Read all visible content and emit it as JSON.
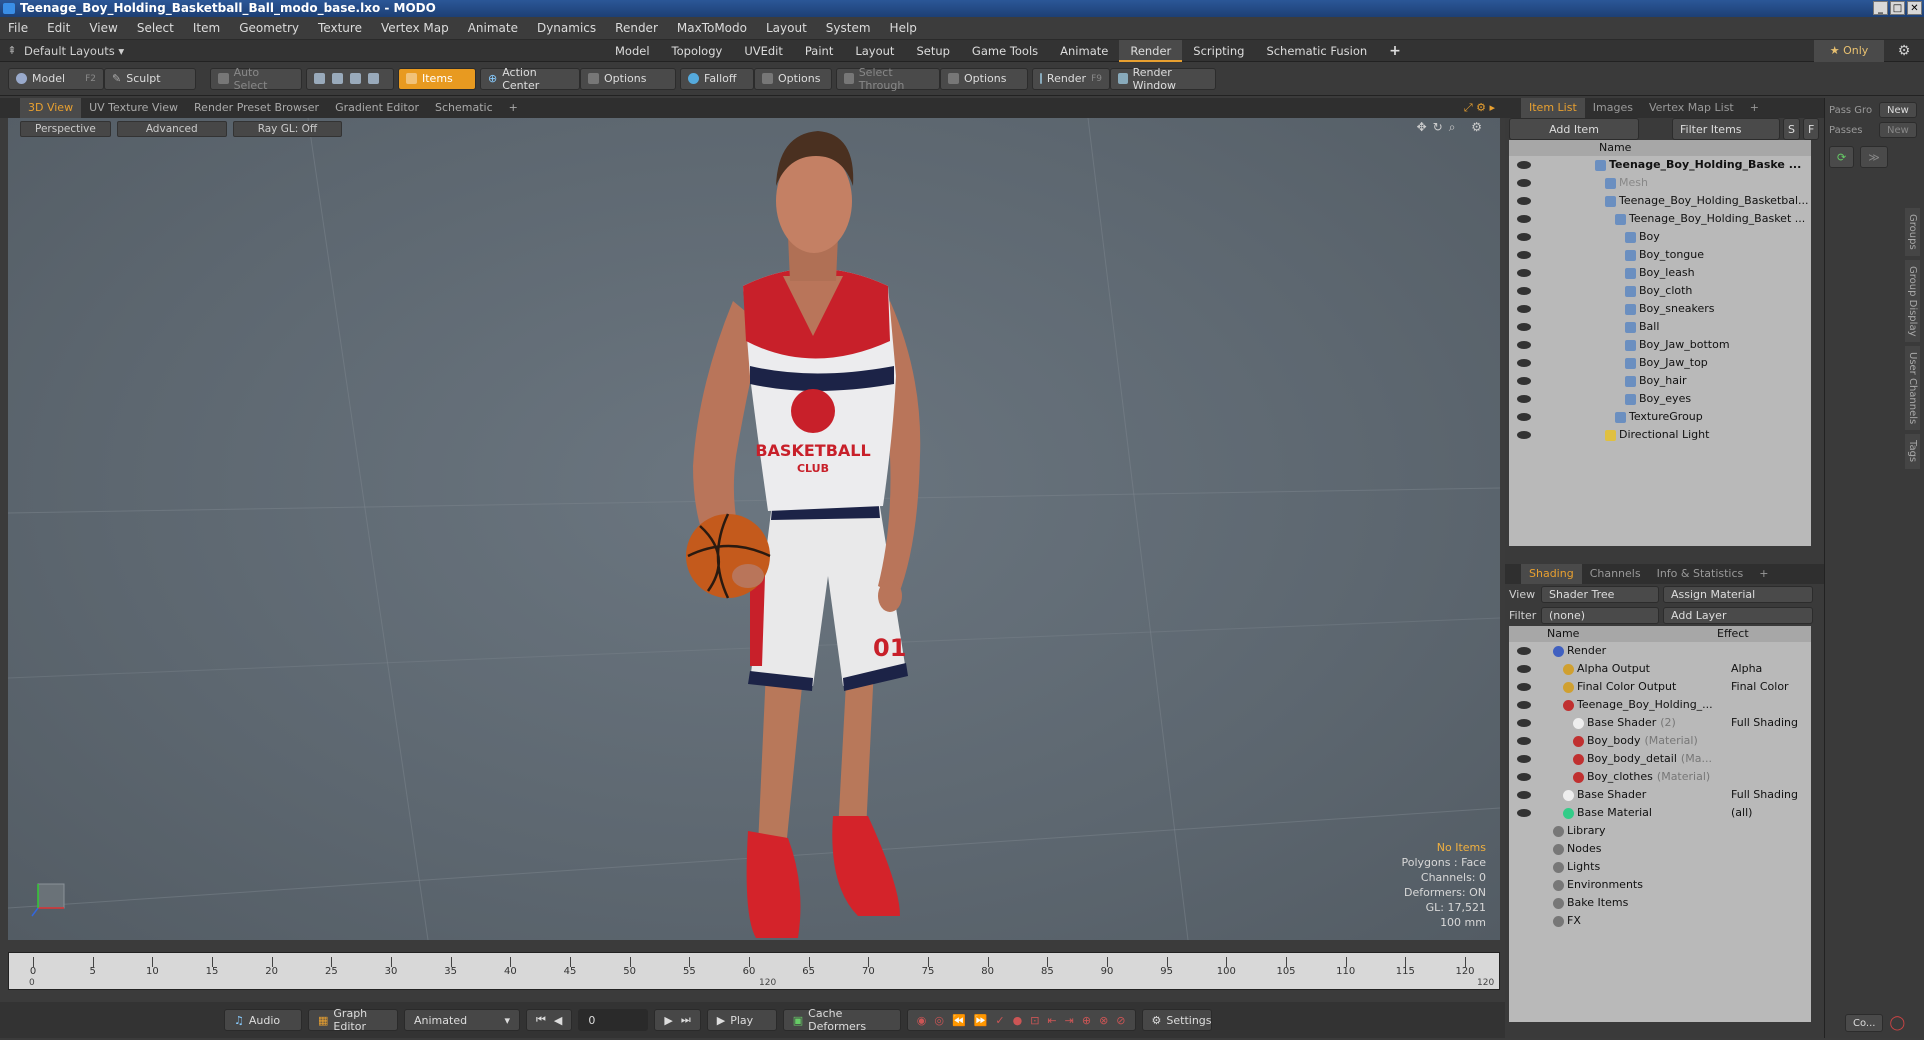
{
  "window": {
    "title": "Teenage_Boy_Holding_Basketball_Ball_modo_base.lxo - MODO"
  },
  "menu": [
    "File",
    "Edit",
    "View",
    "Select",
    "Item",
    "Geometry",
    "Texture",
    "Vertex Map",
    "Animate",
    "Dynamics",
    "Render",
    "MaxToModo",
    "Layout",
    "System",
    "Help"
  ],
  "layouts": {
    "default": "Default Layouts ▾",
    "tabs": [
      "Model",
      "Topology",
      "UVEdit",
      "Paint",
      "Layout",
      "Setup",
      "Game Tools",
      "Animate",
      "Render",
      "Scripting",
      "Schematic Fusion",
      "+"
    ],
    "only": "★ Only"
  },
  "toolbar": {
    "model": "Model",
    "model_key": "F2",
    "sculpt": "Sculpt",
    "auto_select": "Auto Select",
    "items": "Items",
    "action_center": "Action Center",
    "options1": "Options",
    "falloff": "Falloff",
    "options2": "Options",
    "select_through": "Select Through",
    "options3": "Options",
    "render": "Render",
    "render_key": "F9",
    "render_window": "Render Window"
  },
  "viewport": {
    "tabs": [
      "3D View",
      "UV Texture View",
      "Render Preset Browser",
      "Gradient Editor",
      "Schematic",
      "+"
    ],
    "perspective": "Perspective",
    "advanced": "Advanced",
    "raygl": "Ray GL: Off",
    "stats": {
      "no_items": "No Items",
      "polygons": "Polygons : Face",
      "channels": "Channels: 0",
      "deformers": "Deformers: ON",
      "gl": "GL: 17,521",
      "size": "100 mm"
    },
    "jersey_text": "BASKETBALL",
    "jersey_sub": "CLUB",
    "shorts_number": "01"
  },
  "timeline": {
    "ticks": [
      "0",
      "5",
      "10",
      "15",
      "20",
      "25",
      "30",
      "35",
      "40",
      "45",
      "50",
      "55",
      "60",
      "65",
      "70",
      "75",
      "80",
      "85",
      "90",
      "95",
      "100",
      "105",
      "110",
      "115",
      "120"
    ],
    "start": "0",
    "mid": "120",
    "end": "120"
  },
  "bottom": {
    "audio": "Audio",
    "graph_editor": "Graph Editor",
    "animated": "Animated",
    "frame": "0",
    "play": "Play",
    "cache": "Cache Deformers",
    "settings": "Settings"
  },
  "itemlist": {
    "tabs": [
      "Item List",
      "Images",
      "Vertex Map List",
      "+"
    ],
    "add_item": "Add Item",
    "filter": "Filter Items",
    "s": "S",
    "f": "F",
    "name_header": "Name",
    "items": [
      "Teenage_Boy_Holding_Baske ...",
      "Mesh",
      "Teenage_Boy_Holding_Basketbal...",
      "Teenage_Boy_Holding_Basket ...",
      "Boy",
      "Boy_tongue",
      "Boy_leash",
      "Boy_cloth",
      "Boy_sneakers",
      "Ball",
      "Boy_Jaw_bottom",
      "Boy_Jaw_top",
      "Boy_hair",
      "Boy_eyes",
      "TextureGroup",
      "Directional Light"
    ]
  },
  "shading": {
    "tabs": [
      "Shading",
      "Channels",
      "Info & Statistics",
      "+"
    ],
    "view_label": "View",
    "view_value": "Shader Tree",
    "assign": "Assign Material",
    "filter_label": "Filter",
    "filter_value": "(none)",
    "add_layer": "Add Layer",
    "name_header": "Name",
    "effect_header": "Effect",
    "rows": [
      {
        "name": "Render",
        "extra": "",
        "effect": ""
      },
      {
        "name": "Alpha Output",
        "extra": "",
        "effect": "Alpha"
      },
      {
        "name": "Final Color Output",
        "extra": "",
        "effect": "Final Color"
      },
      {
        "name": "Teenage_Boy_Holding_...",
        "extra": "",
        "effect": ""
      },
      {
        "name": "Base Shader",
        "extra": "(2)",
        "effect": "Full Shading"
      },
      {
        "name": "Boy_body",
        "extra": "(Material)",
        "effect": ""
      },
      {
        "name": "Boy_body_detail",
        "extra": "(Ma...",
        "effect": ""
      },
      {
        "name": "Boy_clothes",
        "extra": "(Material)",
        "effect": ""
      },
      {
        "name": "Base Shader",
        "extra": "",
        "effect": "Full Shading"
      },
      {
        "name": "Base Material",
        "extra": "",
        "effect": "(all)"
      },
      {
        "name": "Library",
        "extra": "",
        "effect": ""
      },
      {
        "name": "Nodes",
        "extra": "",
        "effect": ""
      },
      {
        "name": "Lights",
        "extra": "",
        "effect": ""
      },
      {
        "name": "Environments",
        "extra": "",
        "effect": ""
      },
      {
        "name": "Bake Items",
        "extra": "",
        "effect": ""
      },
      {
        "name": "FX",
        "extra": "",
        "effect": ""
      }
    ]
  },
  "farright": {
    "pass_group": "Pass Gro",
    "new1": "New",
    "passes": "Passes",
    "new2": "New",
    "side": [
      "Groups",
      "Group Display",
      "User Channels",
      "Tags"
    ],
    "co": "Co..."
  },
  "colors": {
    "accent": "#e8a030",
    "jersey_red": "#c8202a",
    "navy": "#1c2347"
  }
}
